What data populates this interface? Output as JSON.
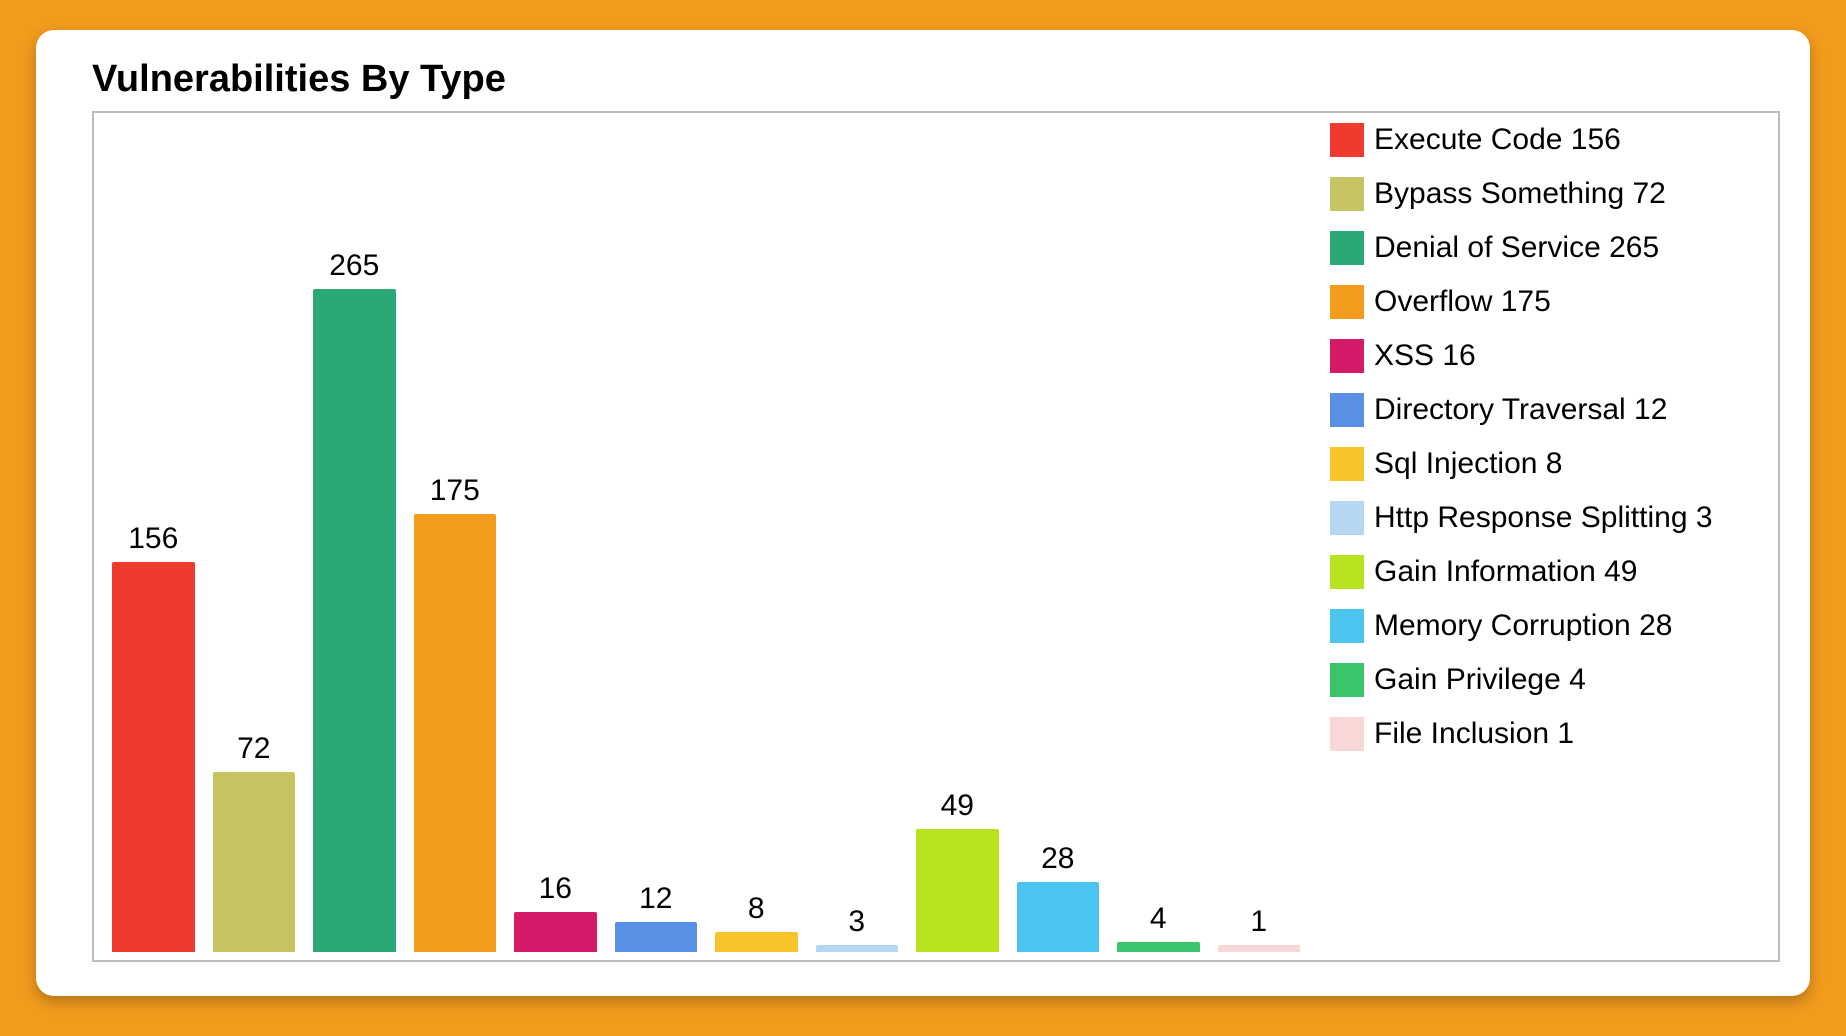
{
  "title": "Vulnerabilities By Type",
  "chart_data": {
    "type": "bar",
    "categories": [
      "Execute Code",
      "Bypass Something",
      "Denial of Service",
      "Overflow",
      "XSS",
      "Directory Traversal",
      "Sql Injection",
      "Http Response Splitting",
      "Gain Information",
      "Memory Corruption",
      "Gain Privilege",
      "File Inclusion"
    ],
    "values": [
      156,
      72,
      265,
      175,
      16,
      12,
      8,
      3,
      49,
      28,
      4,
      1
    ],
    "colors": [
      "#f03a2f",
      "#c7c463",
      "#2aa876",
      "#f29b1d",
      "#d61a6a",
      "#5a8fe6",
      "#f7c52b",
      "#b6d7f2",
      "#b6e31e",
      "#4bc4f0",
      "#3bc46a",
      "#f9d7d7"
    ],
    "ylim": [
      0,
      265
    ],
    "title": "Vulnerabilities By Type",
    "xlabel": "",
    "ylabel": ""
  },
  "legend": [
    {
      "label": "Execute Code 156"
    },
    {
      "label": "Bypass Something 72"
    },
    {
      "label": "Denial of Service 265"
    },
    {
      "label": "Overflow 175"
    },
    {
      "label": "XSS 16"
    },
    {
      "label": "Directory Traversal 12"
    },
    {
      "label": "Sql Injection 8"
    },
    {
      "label": "Http Response Splitting 3"
    },
    {
      "label": "Gain Information 49"
    },
    {
      "label": "Memory Corruption 28"
    },
    {
      "label": "Gain Privilege 4"
    },
    {
      "label": "File Inclusion 1"
    }
  ]
}
